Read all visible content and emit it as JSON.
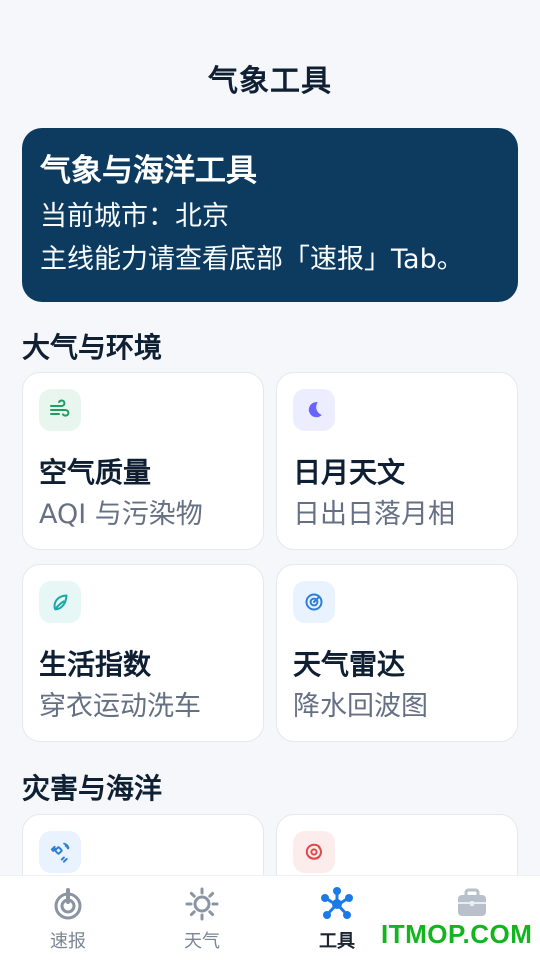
{
  "header": {
    "title": "气象工具"
  },
  "hero": {
    "title": "气象与海洋工具",
    "line1": "当前城市：北京",
    "line2": "主线能力请查看底部「速报」Tab。"
  },
  "sections": {
    "air_environment": "大气与环境",
    "disaster_ocean": "灾害与海洋"
  },
  "cards": [
    {
      "title": "空气质量",
      "subtitle": "AQI 与污染物",
      "icon": "wind-icon",
      "accent": "#1f9d63",
      "bg": "#e8f6ef"
    },
    {
      "title": "日月天文",
      "subtitle": "日出日落月相",
      "icon": "moon-icon",
      "accent": "#6b63ff",
      "bg": "#eceeff"
    },
    {
      "title": "生活指数",
      "subtitle": "穿衣运动洗车",
      "icon": "leaf-icon",
      "accent": "#1aa9a6",
      "bg": "#e6f7f6"
    },
    {
      "title": "天气雷达",
      "subtitle": "降水回波图",
      "icon": "radar-icon",
      "accent": "#2f7fd5",
      "bg": "#e8f3ff"
    },
    {
      "icon": "satellite-icon",
      "accent": "#2f7fd5",
      "bg": "#e8f3ff"
    },
    {
      "icon": "typhoon-icon",
      "accent": "#dd4a4a",
      "bg": "#fdecec"
    }
  ],
  "bottom_nav": [
    {
      "label": "速报",
      "icon": "bullseye-icon",
      "active": false
    },
    {
      "label": "天气",
      "icon": "sun-icon",
      "active": false
    },
    {
      "label": "工具",
      "icon": "network-icon",
      "active": true,
      "accent": "#1c7ae8"
    },
    {
      "label": "",
      "icon": "briefcase-icon",
      "active": false
    }
  ],
  "watermark": {
    "text": "ITMOP.COM",
    "color": "#13b51e"
  }
}
